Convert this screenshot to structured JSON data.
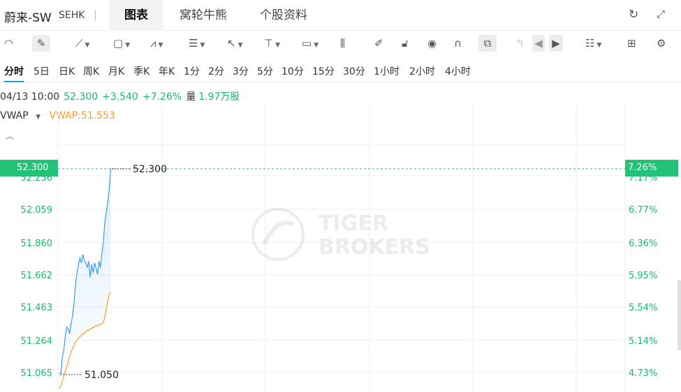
{
  "header": {
    "stock_name": "蔚来-SW",
    "stock_code": "SEHK",
    "tabs": [
      {
        "label": "图表",
        "active": true
      },
      {
        "label": "窝轮牛熊",
        "active": false
      },
      {
        "label": "个股资料",
        "active": false
      }
    ],
    "icons": [
      "refresh-icon",
      "expand-icon"
    ]
  },
  "toolbar": {
    "icons": [
      "gauge-icon",
      "pen-icon",
      "line-icon",
      "rect-icon",
      "wave-icon",
      "fib-icon",
      "arrow-icon",
      "price-icon",
      "text-icon",
      "bars-icon",
      "brush-icon",
      "lock-icon",
      "eye-icon",
      "magnet-icon",
      "link-icon",
      "undo-icon",
      "prev-icon",
      "next-icon",
      "layout-icon",
      "grid-icon",
      "settings-icon"
    ]
  },
  "periods": [
    "分时",
    "5日",
    "日K",
    "周K",
    "月K",
    "季K",
    "年K",
    "1分",
    "2分",
    "3分",
    "5分",
    "10分",
    "15分",
    "30分",
    "1小时",
    "2小时",
    "4小时"
  ],
  "info": {
    "datetime": "04/13 10:00",
    "price": "52.300",
    "change": "+3.540",
    "change_pct": "+7.26%",
    "volume_label": "量",
    "volume": "1.97万股"
  },
  "vwap": {
    "name": "VWAP",
    "value_text": "VWAP:51.553"
  },
  "watermark": {
    "line1": "TIGER",
    "line2": "BROKERS"
  },
  "colors": {
    "price_line": "#3d9be9",
    "vwap_line": "#f0a02a",
    "up_green": "#19b96b",
    "tag_green": "#22c277"
  },
  "chart_data": {
    "type": "line",
    "y_left_ticks": [
      "52.256",
      "52.059",
      "51.860",
      "51.662",
      "51.463",
      "51.264",
      "51.065"
    ],
    "y_right_ticks": [
      "7.17%",
      "6.77%",
      "6.36%",
      "5.95%",
      "5.54%",
      "5.14%",
      "4.73%"
    ],
    "current_price_tag": "52.300",
    "current_pct_tag": "7.26%",
    "high_label": "52.300",
    "low_label": "51.050",
    "ylim": [
      51.0,
      52.3
    ],
    "series": [
      {
        "name": "价格",
        "values": [
          51.065,
          51.05,
          51.16,
          51.2,
          51.28,
          51.34,
          51.33,
          51.3,
          51.36,
          51.41,
          51.49,
          51.6,
          51.67,
          51.72,
          51.76,
          51.73,
          51.78,
          51.74,
          51.73,
          51.7,
          51.74,
          51.64,
          51.72,
          51.67,
          51.73,
          51.7,
          51.66,
          51.74,
          51.7,
          51.79,
          51.86,
          51.98,
          52.04,
          52.1,
          52.18,
          52.3
        ]
      },
      {
        "name": "VWAP",
        "values": [
          50.97,
          50.98,
          51.01,
          51.04,
          51.07,
          51.1,
          51.13,
          51.16,
          51.19,
          51.21,
          51.23,
          51.25,
          51.26,
          51.27,
          51.28,
          51.29,
          51.3,
          51.3,
          51.31,
          51.32,
          51.32,
          51.33,
          51.33,
          51.34,
          51.34,
          51.35,
          51.35,
          51.35,
          51.36,
          51.36,
          51.37,
          51.4,
          51.45,
          51.5,
          51.54,
          51.553
        ]
      }
    ]
  }
}
